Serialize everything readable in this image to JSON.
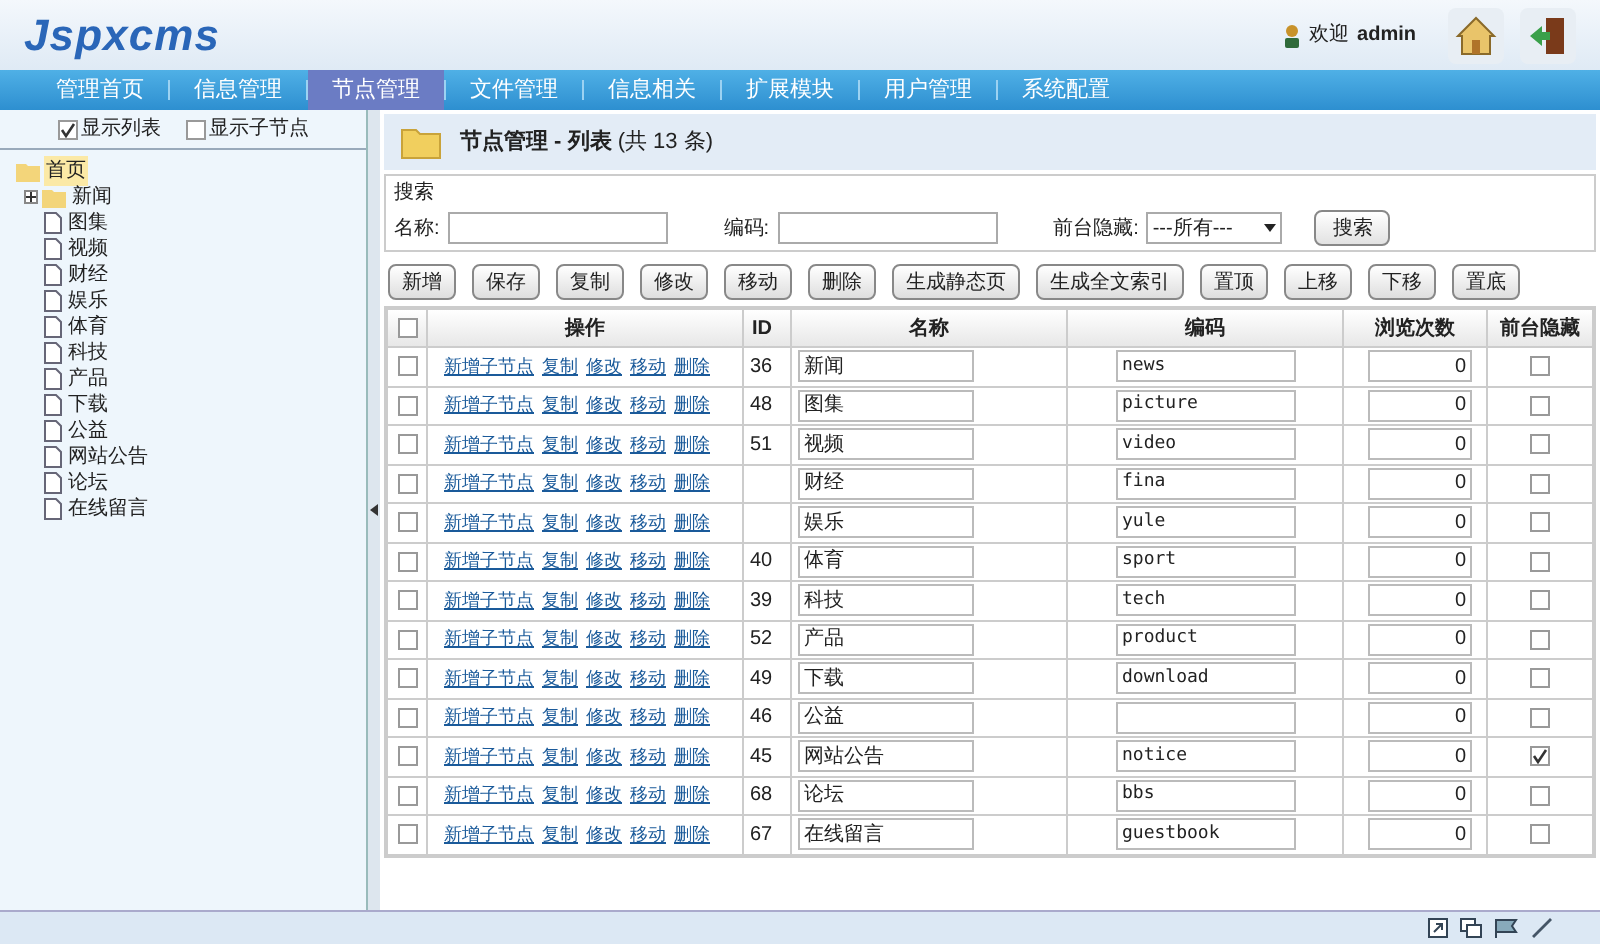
{
  "header": {
    "logo": "Jspxcms",
    "welcome": "欢迎",
    "user": "admin"
  },
  "nav": [
    {
      "label": "管理首页",
      "selected": false
    },
    {
      "label": "信息管理",
      "selected": false
    },
    {
      "label": "节点管理",
      "selected": true
    },
    {
      "label": "文件管理",
      "selected": false
    },
    {
      "label": "信息相关",
      "selected": false
    },
    {
      "label": "扩展模块",
      "selected": false
    },
    {
      "label": "用户管理",
      "selected": false
    },
    {
      "label": "系统配置",
      "selected": false
    }
  ],
  "sidebar": {
    "options": [
      {
        "label": "显示列表",
        "checked": true
      },
      {
        "label": "显示子节点",
        "checked": false
      }
    ],
    "tree": [
      {
        "label": "首页",
        "selected": true,
        "children": [
          {
            "label": "新闻",
            "kind": "folder",
            "expanded": false
          },
          {
            "label": "图集",
            "kind": "page"
          },
          {
            "label": "视频",
            "kind": "page"
          },
          {
            "label": "财经",
            "kind": "page"
          },
          {
            "label": "娱乐",
            "kind": "page"
          },
          {
            "label": "体育",
            "kind": "page"
          },
          {
            "label": "科技",
            "kind": "page"
          },
          {
            "label": "产品",
            "kind": "page"
          },
          {
            "label": "下载",
            "kind": "page"
          },
          {
            "label": "公益",
            "kind": "page"
          },
          {
            "label": "网站公告",
            "kind": "page"
          },
          {
            "label": "论坛",
            "kind": "page"
          },
          {
            "label": "在线留言",
            "kind": "page"
          }
        ]
      }
    ]
  },
  "panel": {
    "title": "节点管理 - 列表",
    "count": "(共 13 条)"
  },
  "search": {
    "legend": "搜索",
    "name_label": "名称:",
    "code_label": "编码:",
    "hidden_label": "前台隐藏:",
    "hidden_value": "---所有---",
    "button": "搜索"
  },
  "toolbar": [
    "新增",
    "保存",
    "复制",
    "修改",
    "移动",
    "删除",
    "生成静态页",
    "生成全文索引",
    "置顶",
    "上移",
    "下移",
    "置底"
  ],
  "table": {
    "select_all_checked": false,
    "columns": [
      "操作",
      "ID",
      "名称",
      "编码",
      "浏览次数",
      "前台隐藏"
    ],
    "rows": [
      {
        "actions": [
          "新增子节点",
          "复制",
          "修改",
          "移动",
          "删除"
        ],
        "id": "36",
        "name": "新闻",
        "code": "news",
        "views": "0",
        "hidden": false,
        "checked": false
      },
      {
        "actions": [
          "新增子节点",
          "复制",
          "修改",
          "移动",
          "删除"
        ],
        "id": "48",
        "name": "图集",
        "code": "picture",
        "views": "0",
        "hidden": false,
        "checked": false
      },
      {
        "actions": [
          "新增子节点",
          "复制",
          "修改",
          "移动",
          "删除"
        ],
        "id": "51",
        "name": "视频",
        "code": "video",
        "views": "0",
        "hidden": false,
        "checked": false
      },
      {
        "actions": [
          "新增子节点",
          "复制",
          "修改",
          "移动",
          "删除"
        ],
        "name": "财经",
        "code": "fina",
        "views": "0",
        "hidden": false,
        "checked": false
      },
      {
        "actions": [
          "新增子节点",
          "复制",
          "修改",
          "移动",
          "删除"
        ],
        "name": "娱乐",
        "code": "yule",
        "views": "0",
        "hidden": false,
        "checked": false
      },
      {
        "actions": [
          "新增子节点",
          "复制",
          "修改",
          "移动",
          "删除"
        ],
        "id": "40",
        "name": "体育",
        "code": "sport",
        "views": "0",
        "hidden": false,
        "checked": false
      },
      {
        "actions": [
          "新增子节点",
          "复制",
          "修改",
          "移动",
          "删除"
        ],
        "id": "39",
        "name": "科技",
        "code": "tech",
        "views": "0",
        "hidden": false,
        "checked": false
      },
      {
        "actions": [
          "新增子节点",
          "复制",
          "修改",
          "移动",
          "删除"
        ],
        "id": "52",
        "name": "产品",
        "code": "product",
        "views": "0",
        "hidden": false,
        "checked": false
      },
      {
        "actions": [
          "新增子节点",
          "复制",
          "修改",
          "移动",
          "删除"
        ],
        "id": "49",
        "name": "下载",
        "code": "download",
        "views": "0",
        "hidden": false,
        "checked": false
      },
      {
        "actions": [
          "新增子节点",
          "复制",
          "修改",
          "移动",
          "删除"
        ],
        "id": "46",
        "name": "公益",
        "views": "0",
        "hidden": false,
        "checked": false
      },
      {
        "actions": [
          "新增子节点",
          "复制",
          "修改",
          "移动",
          "删除"
        ],
        "id": "45",
        "name": "网站公告",
        "code": "notice",
        "views": "0",
        "hidden": true,
        "checked": false
      },
      {
        "actions": [
          "新增子节点",
          "复制",
          "修改",
          "移动",
          "删除"
        ],
        "id": "68",
        "name": "论坛",
        "code": "bbs",
        "views": "0",
        "hidden": false,
        "checked": false
      },
      {
        "actions": [
          "新增子节点",
          "复制",
          "修改",
          "移动",
          "删除"
        ],
        "id": "67",
        "name": "在线留言",
        "code": "guestbook",
        "views": "0",
        "hidden": false,
        "checked": false
      }
    ]
  }
}
